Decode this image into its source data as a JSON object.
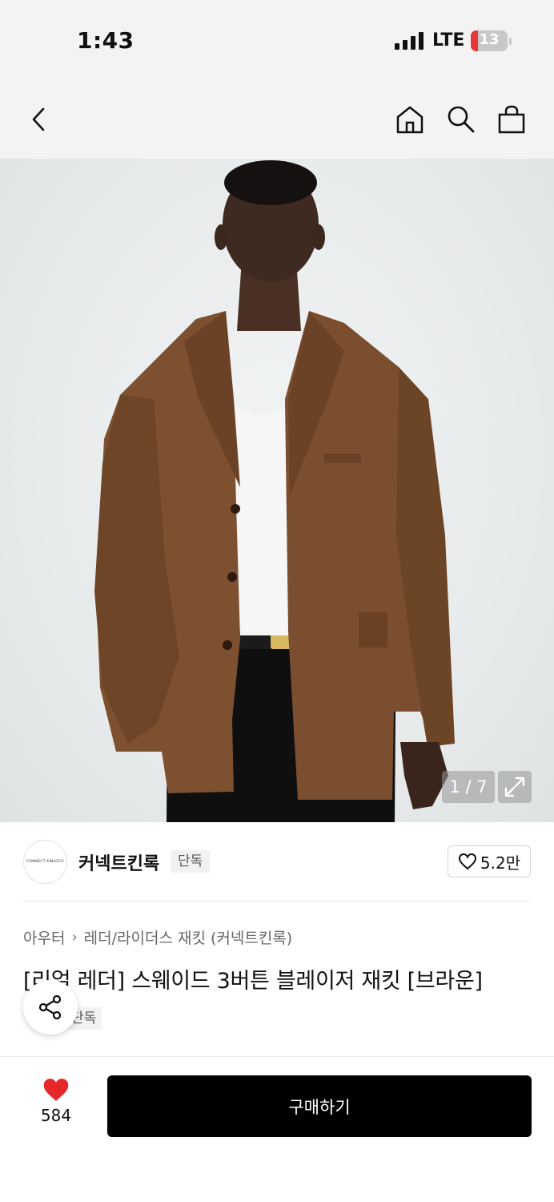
{
  "status_bar": {
    "time": "1:43",
    "network": "LTE",
    "battery": "13"
  },
  "nav": {
    "icons": [
      "back-arrow-icon",
      "home-icon",
      "search-icon",
      "shopping-bag-icon"
    ]
  },
  "gallery": {
    "counter": "1 / 7"
  },
  "brand": {
    "logo_text": "CONNECT KINLOCH",
    "name": "커넥트킨록",
    "badge": "단독",
    "likes": "5.2만"
  },
  "breadcrumb": {
    "category": "아우터",
    "subcategory": "레더/라이더스 재킷 (커넥트킨록)"
  },
  "product": {
    "title": "[리얼 레더] 스웨이드 3버튼 블레이저 재킷 [브라운]",
    "tag": "단독"
  },
  "bottom": {
    "wish_count": "584",
    "buy_label": "구매하기"
  },
  "colors": {
    "accent_red": "#e5262a",
    "buy_button": "#000000"
  }
}
